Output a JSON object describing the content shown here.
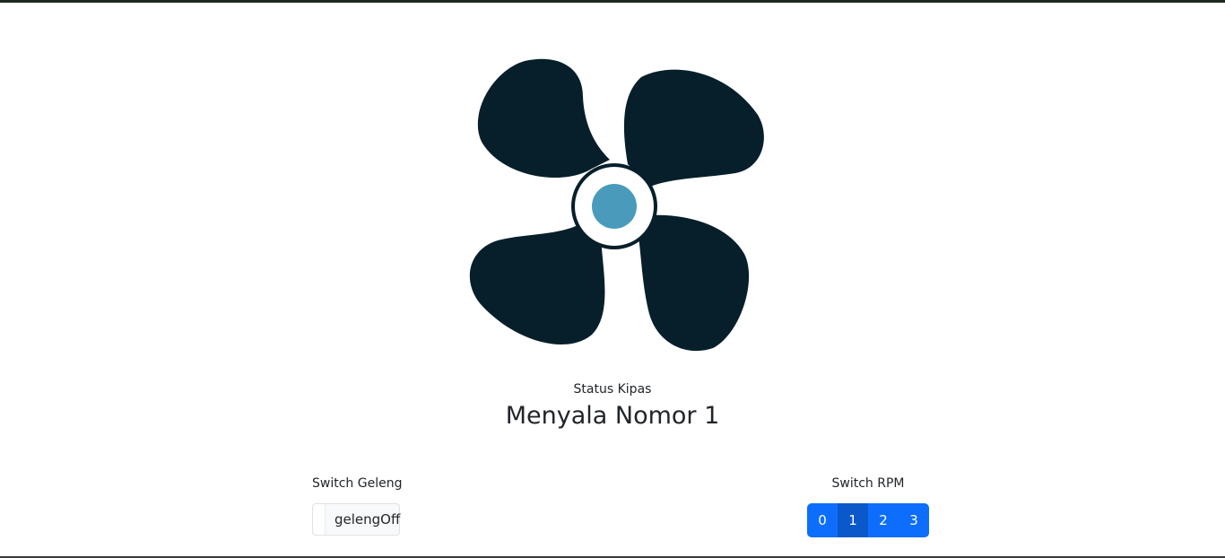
{
  "fan": {
    "icon": "fan-icon",
    "blade_color": "#061f2b",
    "hub_ring_color": "#ffffff",
    "hub_color": "#4a9bbb"
  },
  "status": {
    "label": "Status Kipas",
    "value": "Menyala Nomor 1"
  },
  "geleng": {
    "label": "Switch Geleng",
    "toggle_text": "gelengOff"
  },
  "rpm": {
    "label": "Switch RPM",
    "options": [
      "0",
      "1",
      "2",
      "3"
    ],
    "selected": "1",
    "button_color": "#0d6efd",
    "active_color": "#0a58ca"
  }
}
